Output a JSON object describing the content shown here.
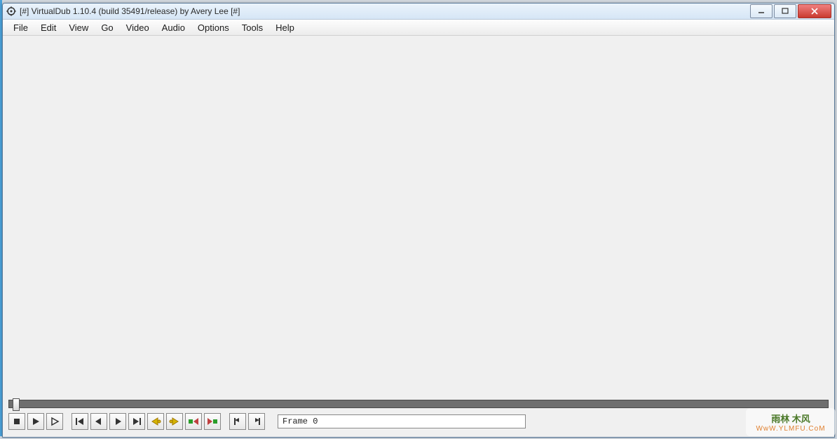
{
  "titlebar": {
    "title": "[#] VirtualDub 1.10.4 (build 35491/release) by Avery Lee [#]"
  },
  "menu": {
    "items": [
      "File",
      "Edit",
      "View",
      "Go",
      "Video",
      "Audio",
      "Options",
      "Tools",
      "Help"
    ]
  },
  "toolbar": {
    "buttons": [
      {
        "name": "stop-button",
        "icon": "stop"
      },
      {
        "name": "play-input-button",
        "icon": "play"
      },
      {
        "name": "play-output-button",
        "icon": "play-o"
      },
      {
        "name": "go-start-button",
        "icon": "go-start"
      },
      {
        "name": "prev-frame-button",
        "icon": "prev"
      },
      {
        "name": "next-frame-button",
        "icon": "next"
      },
      {
        "name": "go-end-button",
        "icon": "go-end"
      },
      {
        "name": "key-prev-button",
        "icon": "key-prev"
      },
      {
        "name": "key-next-button",
        "icon": "key-next"
      },
      {
        "name": "scene-prev-button",
        "icon": "scene-prev"
      },
      {
        "name": "scene-next-button",
        "icon": "scene-next"
      },
      {
        "name": "mark-in-button",
        "icon": "mark-in"
      },
      {
        "name": "mark-out-button",
        "icon": "mark-out"
      }
    ]
  },
  "status": {
    "frame_label": "Frame 0"
  },
  "watermark": {
    "line1": "雨林 木风",
    "line2": "WwW.YLMFU.CoM"
  }
}
